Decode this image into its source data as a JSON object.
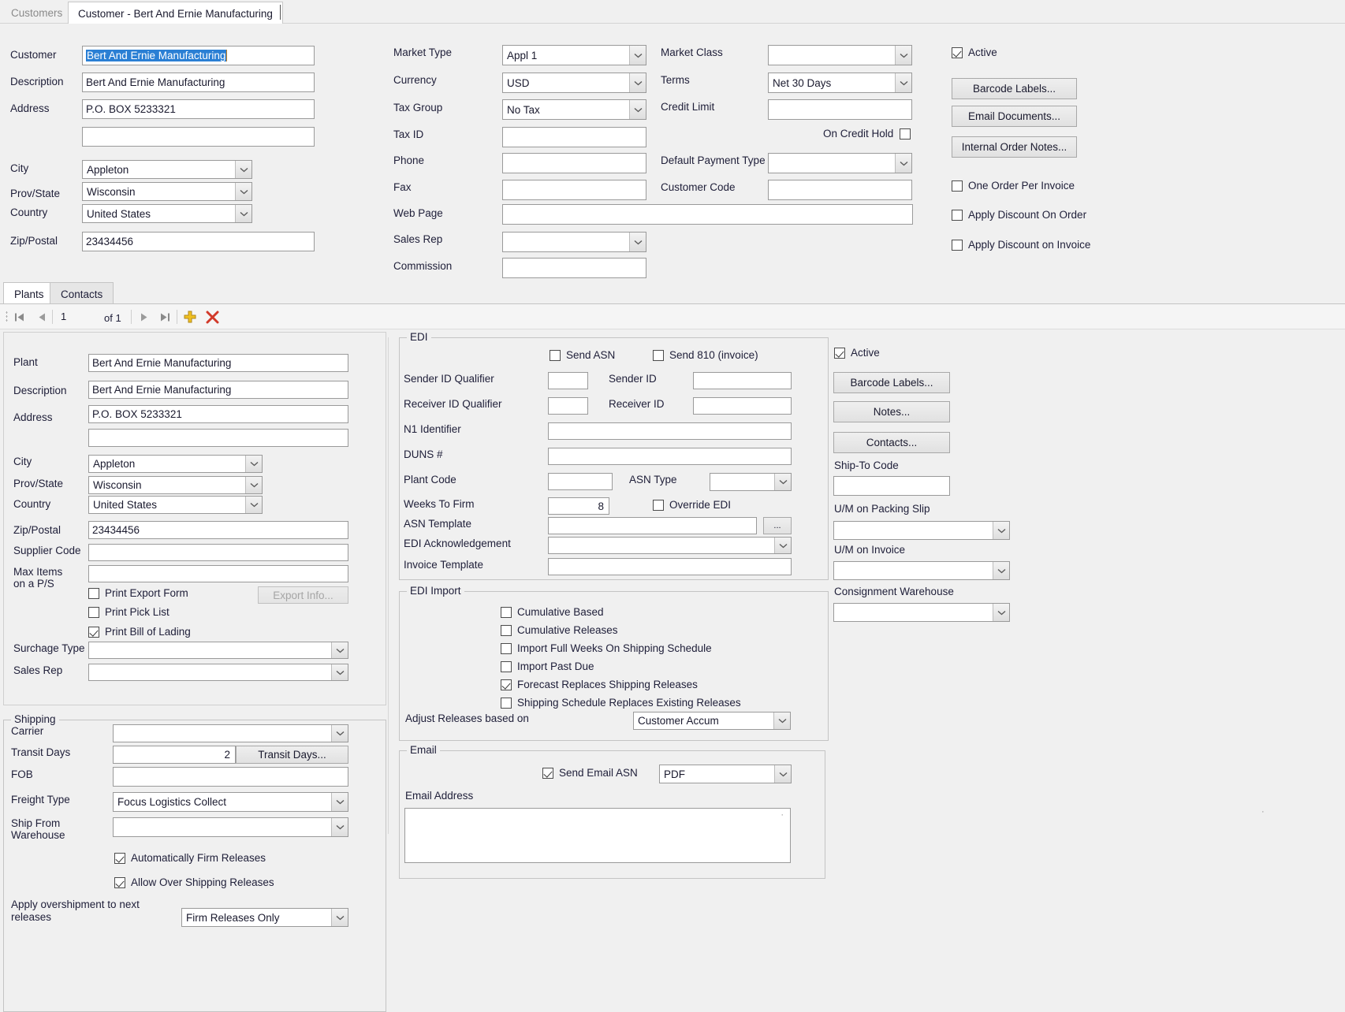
{
  "window": {
    "tabs": [
      {
        "label": "Customers",
        "active": false
      },
      {
        "label": "Customer - Bert And Ernie Manufacturing",
        "active": true
      }
    ]
  },
  "customer": {
    "labels": {
      "customer": "Customer",
      "description": "Description",
      "address": "Address",
      "city": "City",
      "prov_state": "Prov/State",
      "country": "Country",
      "zip_postal": "Zip/Postal",
      "market_type": "Market Type",
      "currency": "Currency",
      "tax_group": "Tax Group",
      "tax_id": "Tax ID",
      "phone": "Phone",
      "fax": "Fax",
      "web_page": "Web Page",
      "sales_rep": "Sales Rep",
      "commission": "Commission",
      "market_class": "Market Class",
      "terms": "Terms",
      "credit_limit": "Credit Limit",
      "on_credit_hold": "On Credit Hold",
      "default_payment_type": "Default Payment Type",
      "customer_code": "Customer Code"
    },
    "values": {
      "customer": "Bert And Ernie Manufacturing",
      "description": "Bert And Ernie Manufacturing",
      "address1": "P.O. BOX 5233321",
      "address2": "",
      "city": "Appleton",
      "prov_state": "Wisconsin",
      "country": "United States",
      "zip_postal": "23434456",
      "market_type": "Appl 1",
      "currency": "USD",
      "tax_group": "No Tax",
      "tax_id": "",
      "phone": "",
      "fax": "",
      "web_page": "",
      "sales_rep": "",
      "commission": "",
      "market_class": "",
      "terms": "Net 30 Days",
      "credit_limit": "",
      "default_payment_type": "",
      "customer_code": ""
    },
    "checkboxes": {
      "active": {
        "label": "Active",
        "checked": true
      },
      "on_credit_hold": {
        "label": "On Credit Hold",
        "checked": false
      },
      "one_order_per_invoice": {
        "label": "One Order Per Invoice",
        "checked": false
      },
      "apply_discount_on_order": {
        "label": "Apply Discount On Order",
        "checked": false
      },
      "apply_discount_on_invoice": {
        "label": "Apply Discount on Invoice",
        "checked": false
      }
    },
    "buttons": {
      "barcode_labels": "Barcode Labels...",
      "email_documents": "Email Documents...",
      "internal_order_notes": "Internal Order Notes..."
    }
  },
  "subtabs": [
    {
      "label": "Plants",
      "active": true
    },
    {
      "label": "Contacts",
      "active": false
    }
  ],
  "navigator": {
    "current_record": "1",
    "of_label": "of 1",
    "icons": [
      "first-record-icon",
      "previous-record-icon",
      "next-record-icon",
      "last-record-icon",
      "add-record-icon",
      "delete-record-icon"
    ]
  },
  "plant": {
    "labels": {
      "plant": "Plant",
      "description": "Description",
      "address": "Address",
      "city": "City",
      "prov_state": "Prov/State",
      "country": "Country",
      "zip_postal": "Zip/Postal",
      "supplier_code": "Supplier Code",
      "max_items": "Max Items\non a P/S",
      "surcharge_type": "Surchage Type",
      "sales_rep": "Sales Rep"
    },
    "values": {
      "plant": "Bert And Ernie Manufacturing",
      "description": "Bert And Ernie Manufacturing",
      "address1": "P.O. BOX 5233321",
      "address2": "",
      "city": "Appleton",
      "prov_state": "Wisconsin",
      "country": "United States",
      "zip_postal": "23434456",
      "supplier_code": "",
      "max_items": "",
      "surcharge_type": "",
      "sales_rep": ""
    },
    "checkboxes": {
      "print_export_form": {
        "label": "Print Export Form",
        "checked": false
      },
      "print_pick_list": {
        "label": "Print Pick List",
        "checked": false
      },
      "print_bill_of_lading": {
        "label": "Print Bill of Lading",
        "checked": true
      }
    },
    "buttons": {
      "export_info": "Export Info..."
    }
  },
  "shipping": {
    "group_title": "Shipping",
    "labels": {
      "carrier": "Carrier",
      "transit_days": "Transit Days",
      "fob": "FOB",
      "freight_type": "Freight Type",
      "ship_from_warehouse": "Ship From\nWarehouse",
      "apply_overshipment": "Apply overshipment to next\nreleases"
    },
    "values": {
      "carrier": "",
      "transit_days": "2",
      "fob": "",
      "freight_type": "Focus Logistics Collect",
      "ship_from_warehouse": "",
      "apply_overshipment": "Firm Releases Only"
    },
    "checkboxes": {
      "automatically_firm_releases": {
        "label": "Automatically Firm Releases",
        "checked": true
      },
      "allow_over_shipping_releases": {
        "label": "Allow Over Shipping Releases",
        "checked": true
      }
    },
    "buttons": {
      "transit_days": "Transit Days..."
    }
  },
  "edi": {
    "group_title": "EDI",
    "labels": {
      "sender_id_qualifier": "Sender ID Qualifier",
      "sender_id": "Sender ID",
      "receiver_id_qualifier": "Receiver ID Qualifier",
      "receiver_id": "Receiver ID",
      "n1_identifier": "N1 Identifier",
      "duns": "DUNS #",
      "plant_code": "Plant Code",
      "asn_type": "ASN Type",
      "weeks_to_firm": "Weeks To Firm",
      "asn_template": "ASN Template",
      "edi_acknowledgement": "EDI Acknowledgement",
      "invoice_template": "Invoice Template"
    },
    "values": {
      "sender_id_qualifier": "",
      "sender_id": "",
      "receiver_id_qualifier": "",
      "receiver_id": "",
      "n1_identifier": "",
      "duns": "",
      "plant_code": "",
      "asn_type": "",
      "weeks_to_firm": "8",
      "asn_template": "",
      "edi_acknowledgement": "",
      "invoice_template": ""
    },
    "checkboxes": {
      "send_asn": {
        "label": "Send ASN",
        "checked": false
      },
      "send_810": {
        "label": "Send 810 (invoice)",
        "checked": false
      },
      "override_edi": {
        "label": "Override EDI",
        "checked": false
      }
    },
    "buttons": {
      "browse": "..."
    }
  },
  "edi_import": {
    "group_title": "EDI Import",
    "checkboxes": [
      {
        "label": "Cumulative Based",
        "checked": false
      },
      {
        "label": "Cumulative Releases",
        "checked": false
      },
      {
        "label": "Import Full Weeks On Shipping Schedule",
        "checked": false
      },
      {
        "label": "Import Past Due",
        "checked": false
      },
      {
        "label": "Forecast Replaces Shipping Releases",
        "checked": true
      },
      {
        "label": "Shipping Schedule Replaces Existing Releases",
        "checked": false
      }
    ],
    "adjust_label": "Adjust Releases based on",
    "adjust_value": "Customer Accum"
  },
  "email": {
    "group_title": "Email",
    "send_email_asn": {
      "label": "Send Email ASN",
      "checked": true
    },
    "format": "PDF",
    "address_label": "Email Address",
    "address_value": ""
  },
  "plant_right": {
    "active": {
      "label": "Active",
      "checked": true
    },
    "buttons": {
      "barcode_labels": "Barcode Labels...",
      "notes": "Notes...",
      "contacts": "Contacts..."
    },
    "labels": {
      "ship_to_code": "Ship-To Code",
      "um_packing_slip": "U/M on Packing Slip",
      "um_invoice": "U/M on Invoice",
      "consignment_warehouse": "Consignment Warehouse"
    },
    "values": {
      "ship_to_code": "",
      "um_packing_slip": "",
      "um_invoice": "",
      "consignment_warehouse": ""
    }
  },
  "colors": {
    "background": "#f0f0f0",
    "selection_blue": "#2a7fd4",
    "caret_orange": "#c47f20",
    "delete_red": "#d23a2a",
    "add_yellow": "#f0c020"
  }
}
